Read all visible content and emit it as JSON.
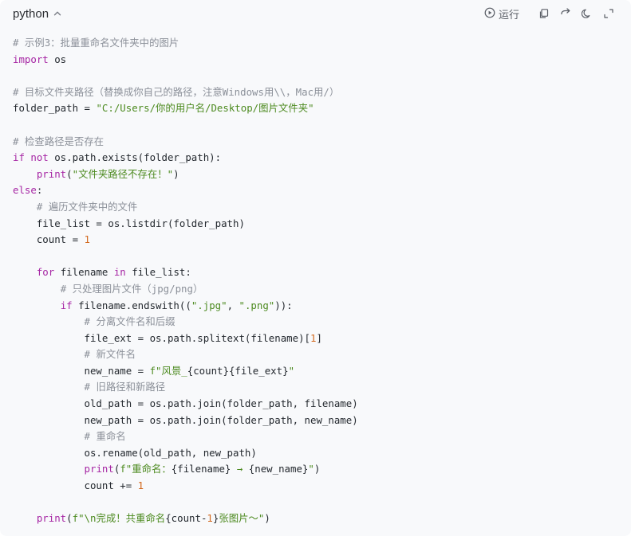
{
  "header": {
    "language": "python",
    "run_label": "运行"
  },
  "icons": {
    "language_toggle": "chevron-up-icon",
    "run": "play-circle-icon",
    "copy": "copy-icon",
    "wrap": "wrap-arrow-icon",
    "theme": "moon-icon",
    "expand": "expand-icon"
  },
  "colors": {
    "comment": "#8b9099",
    "keyword": "#a626a4",
    "string": "#4c8a1f",
    "number": "#d2691e",
    "text": "#24292f",
    "background": "#f8f9fb"
  },
  "code": [
    [
      [
        "c",
        "# 示例3：批量重命名文件夹中的图片"
      ]
    ],
    [
      [
        "k",
        "import"
      ],
      [
        "",
        " os"
      ]
    ],
    [
      [
        "",
        ""
      ]
    ],
    [
      [
        "c",
        "# 目标文件夹路径（替换成你自己的路径，注意Windows用\\\\，Mac用/）"
      ]
    ],
    [
      [
        "",
        "folder_path = "
      ],
      [
        "s",
        "\"C:/Users/你的用户名/Desktop/图片文件夹\""
      ]
    ],
    [
      [
        "",
        ""
      ]
    ],
    [
      [
        "c",
        "# 检查路径是否存在"
      ]
    ],
    [
      [
        "k",
        "if not"
      ],
      [
        "",
        " os.path.exists(folder_path):"
      ]
    ],
    [
      [
        "",
        "    "
      ],
      [
        "f",
        "print"
      ],
      [
        "",
        "("
      ],
      [
        "s",
        "\"文件夹路径不存在！\""
      ],
      [
        "",
        ")"
      ]
    ],
    [
      [
        "k",
        "else"
      ],
      [
        "",
        ":"
      ]
    ],
    [
      [
        "",
        "    "
      ],
      [
        "c",
        "# 遍历文件夹中的文件"
      ]
    ],
    [
      [
        "",
        "    file_list = os.listdir(folder_path)"
      ]
    ],
    [
      [
        "",
        "    count = "
      ],
      [
        "n",
        "1"
      ]
    ],
    [
      [
        "",
        ""
      ]
    ],
    [
      [
        "",
        "    "
      ],
      [
        "k",
        "for"
      ],
      [
        "",
        " filename "
      ],
      [
        "k",
        "in"
      ],
      [
        "",
        " file_list:"
      ]
    ],
    [
      [
        "",
        "        "
      ],
      [
        "c",
        "# 只处理图片文件（jpg/png）"
      ]
    ],
    [
      [
        "",
        "        "
      ],
      [
        "k",
        "if"
      ],
      [
        "",
        " filename.endswith(("
      ],
      [
        "s",
        "\".jpg\""
      ],
      [
        "",
        ", "
      ],
      [
        "s",
        "\".png\""
      ],
      [
        "",
        ")):"
      ]
    ],
    [
      [
        "",
        "            "
      ],
      [
        "c",
        "# 分离文件名和后缀"
      ]
    ],
    [
      [
        "",
        "            file_ext = os.path.splitext(filename)["
      ],
      [
        "n",
        "1"
      ],
      [
        "",
        "]"
      ]
    ],
    [
      [
        "",
        "            "
      ],
      [
        "c",
        "# 新文件名"
      ]
    ],
    [
      [
        "",
        "            new_name = "
      ],
      [
        "s",
        "f\"风景_"
      ],
      [
        "",
        "{count}{file_ext}"
      ],
      [
        "s",
        "\""
      ]
    ],
    [
      [
        "",
        "            "
      ],
      [
        "c",
        "# 旧路径和新路径"
      ]
    ],
    [
      [
        "",
        "            old_path = os.path.join(folder_path, filename)"
      ]
    ],
    [
      [
        "",
        "            new_path = os.path.join(folder_path, new_name)"
      ]
    ],
    [
      [
        "",
        "            "
      ],
      [
        "c",
        "# 重命名"
      ]
    ],
    [
      [
        "",
        "            os.rename(old_path, new_path)"
      ]
    ],
    [
      [
        "",
        "            "
      ],
      [
        "f",
        "print"
      ],
      [
        "",
        "("
      ],
      [
        "s",
        "f\"重命名："
      ],
      [
        "",
        "{filename}"
      ],
      [
        "s",
        " → "
      ],
      [
        "",
        "{new_name}"
      ],
      [
        "s",
        "\""
      ],
      [
        "",
        ")"
      ]
    ],
    [
      [
        "",
        "            count += "
      ],
      [
        "n",
        "1"
      ]
    ],
    [
      [
        "",
        ""
      ]
    ],
    [
      [
        "",
        "    "
      ],
      [
        "f",
        "print"
      ],
      [
        "",
        "("
      ],
      [
        "s",
        "f\"\\n完成！共重命名"
      ],
      [
        "",
        "{count-"
      ],
      [
        "n",
        "1"
      ],
      [
        "",
        "}"
      ],
      [
        "s",
        "张图片～\""
      ],
      [
        "",
        ")"
      ]
    ]
  ]
}
